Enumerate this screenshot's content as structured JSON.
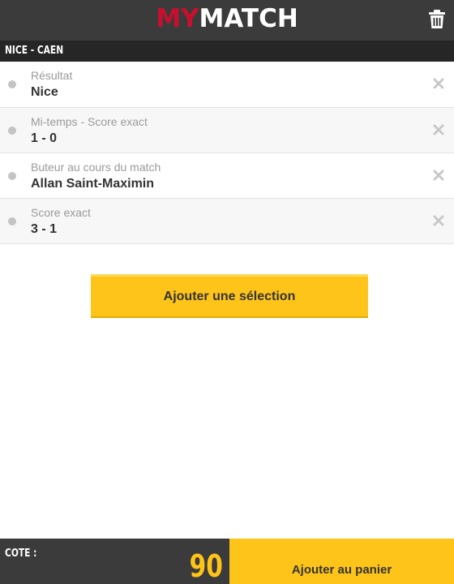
{
  "header": {
    "logo_part1": "MY",
    "logo_part2": "MATCH",
    "trash_icon": "trash-icon"
  },
  "match": {
    "title": "NICE - CAEN"
  },
  "selections": [
    {
      "label": "Résultat",
      "value": "Nice"
    },
    {
      "label": "Mi-temps - Score exact",
      "value": "1 - 0"
    },
    {
      "label": "Buteur au cours du match",
      "value": "Allan Saint-Maximin"
    },
    {
      "label": "Score exact",
      "value": "3 - 1"
    }
  ],
  "add_selection_label": "Ajouter une sélection",
  "footer": {
    "cote_label": "COTE :",
    "cote_value": "90",
    "panier_label": "Ajouter au panier"
  },
  "colors": {
    "accent": "#ffc41a",
    "brand_red": "#c8102e",
    "header_bg": "#3b3b3b",
    "matchbar_bg": "#262626"
  }
}
